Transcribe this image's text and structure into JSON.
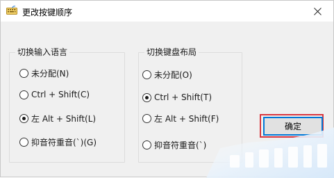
{
  "window": {
    "title": "更改按键顺序",
    "icons": {
      "app": "keyboard-icon",
      "close": "close-icon"
    }
  },
  "input_language_group": {
    "legend": "切换输入语言",
    "options": [
      {
        "label": "未分配(N)",
        "selected": false
      },
      {
        "label": "Ctrl + Shift(C)",
        "selected": false
      },
      {
        "label": "左 Alt + Shift(L)",
        "selected": true
      },
      {
        "label": "抑音符重音(`)(G)",
        "selected": false
      }
    ]
  },
  "keyboard_layout_group": {
    "legend": "切换键盘布局",
    "options": [
      {
        "label": "未分配(O)",
        "selected": false
      },
      {
        "label": "Ctrl + Shift(T)",
        "selected": true
      },
      {
        "label": "左 Alt + Shift(F)",
        "selected": false
      },
      {
        "label": "抑音符重音(`)",
        "selected": false
      }
    ]
  },
  "buttons": {
    "ok": "确定"
  },
  "colors": {
    "highlight_box": "#d9363e",
    "focus_border": "#0078d7",
    "watermark": "#cfe3f7"
  }
}
